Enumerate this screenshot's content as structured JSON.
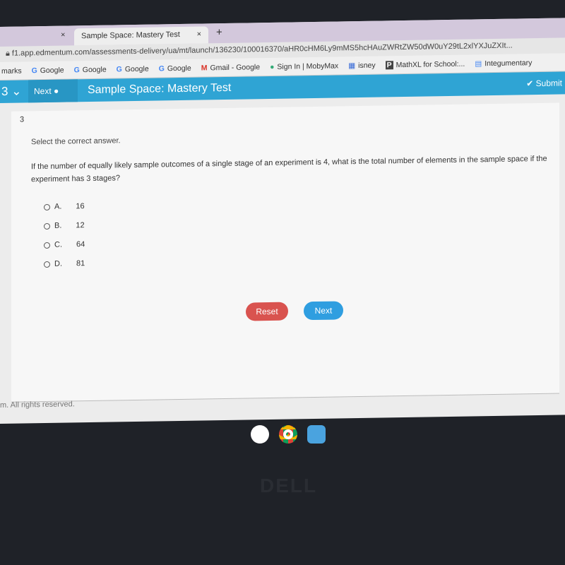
{
  "browser": {
    "tab_title": "Sample Space: Mastery Test",
    "url": "f1.app.edmentum.com/assessments-delivery/ua/mt/launch/136230/100016370/aHR0cHM6Ly9mMS5hcHAuZWRtZW50dW0uY29tL2xlYXJuZXIt...",
    "bookmarks": [
      "marks",
      "Google",
      "Google",
      "Google",
      "Google",
      "Gmail - Google",
      "Sign In | MobyMax",
      "isney",
      "MathXL for School:...",
      "Integumentary"
    ]
  },
  "app": {
    "question_number": "3",
    "next_label": "Next",
    "title": "Sample Space: Mastery Test",
    "submit_label": "Submit"
  },
  "question": {
    "number": "3",
    "instruction": "Select the correct answer.",
    "text": "If the number of equally likely sample outcomes of a single stage of an experiment is 4, what is the total number of elements in the sample space if the experiment has 3 stages?",
    "options": [
      {
        "letter": "A.",
        "value": "16"
      },
      {
        "letter": "B.",
        "value": "12"
      },
      {
        "letter": "C.",
        "value": "64"
      },
      {
        "letter": "D.",
        "value": "81"
      }
    ]
  },
  "buttons": {
    "reset": "Reset",
    "next": "Next"
  },
  "footer": "m. All rights reserved.",
  "brand": "DELL"
}
